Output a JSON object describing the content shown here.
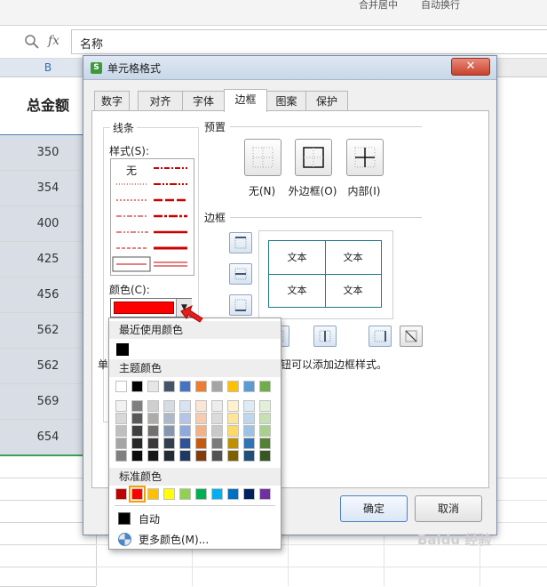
{
  "formula_bar": {
    "fx_label": "fx",
    "cell_value": "名称"
  },
  "sheet": {
    "column_header": "B",
    "header_cell": "总金额",
    "values": [
      "350",
      "354",
      "400",
      "425",
      "456",
      "562",
      "562",
      "569",
      "654"
    ]
  },
  "ribbon": {
    "merge_label": "合并居中",
    "wrap_label": "自动换行"
  },
  "dialog": {
    "title": "单元格格式",
    "close_symbol": "✕",
    "tabs": [
      "数字",
      "对齐",
      "字体",
      "边框",
      "图案",
      "保护"
    ],
    "active_tab": "边框",
    "line_group": {
      "title": "线条",
      "style_label": "样式(S):",
      "none_label": "无",
      "color_label": "颜色(C):"
    },
    "preset": {
      "title": "预置",
      "none": "无(N)",
      "outline": "外边框(O)",
      "inside": "内部(I)"
    },
    "border": {
      "title": "边框",
      "cell_text": "文本"
    },
    "hint_text": "单",
    "hint_text_right": "钮可以添加边框样式。",
    "ok": "确定",
    "cancel": "取消"
  },
  "color_popup": {
    "recent_title": "最近使用颜色",
    "theme_title": "主题颜色",
    "standard_title": "标准颜色",
    "auto_label": "自动",
    "more_label": "更多颜色(M)...",
    "selected_color": "#ff0000",
    "theme_top": [
      "#ffffff",
      "#000000",
      "#e7e6e6",
      "#44546a",
      "#4472c4",
      "#ed7d31",
      "#a5a5a5",
      "#ffc000",
      "#5b9bd5",
      "#70ad47"
    ],
    "theme_shades": [
      [
        "#f2f2f2",
        "#7f7f7f",
        "#d0cece",
        "#d6dce4",
        "#d9e2f3",
        "#fbe5d5",
        "#ededed",
        "#fff2cc",
        "#deebf6",
        "#e2efd9"
      ],
      [
        "#d8d8d8",
        "#595959",
        "#aeabab",
        "#adb9ca",
        "#b4c6e7",
        "#f7cbac",
        "#dbdbdb",
        "#fee599",
        "#bdd7ee",
        "#c5e0b3"
      ],
      [
        "#bfbfbf",
        "#3f3f3f",
        "#757070",
        "#8496b0",
        "#8eaadb",
        "#f4b183",
        "#c9c9c9",
        "#ffd965",
        "#9cc3e5",
        "#a8d08d"
      ],
      [
        "#a5a5a5",
        "#262626",
        "#3a3838",
        "#323f4f",
        "#2f5496",
        "#c55a11",
        "#7b7b7b",
        "#bf9000",
        "#2e75b5",
        "#538135"
      ],
      [
        "#7f7f7f",
        "#0c0c0c",
        "#171616",
        "#222a35",
        "#1f3864",
        "#833c0b",
        "#525252",
        "#7f6000",
        "#1e4e79",
        "#375623"
      ]
    ],
    "standard": [
      "#c00000",
      "#ff0000",
      "#ffc000",
      "#ffff00",
      "#92d050",
      "#00b050",
      "#00b0f0",
      "#0070c0",
      "#002060",
      "#7030a0"
    ]
  },
  "watermark": "Baidu 经验"
}
